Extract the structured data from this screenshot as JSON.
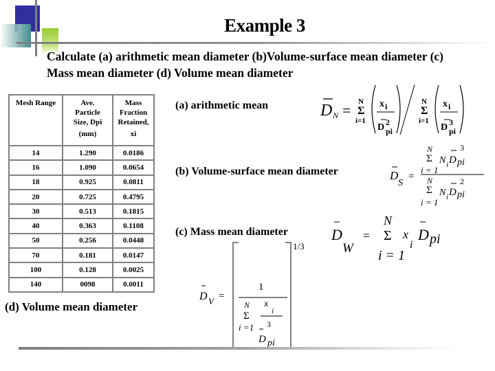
{
  "slide": {
    "title": "Example 3",
    "intro": "Calculate (a) arithmetic mean diameter (b)Volume-surface mean diameter  (c) Mass mean diameter (d) Volume mean diameter"
  },
  "table": {
    "headers": [
      "Mesh Range",
      "Ave. Particle Size, Dpi (mm)",
      "Mass Fraction Retained, xi"
    ],
    "header_lines": [
      [
        "Mesh Range"
      ],
      [
        "Ave.",
        "Particle",
        "Size, Dpi",
        "(mm)"
      ],
      [
        "Mass",
        "Fraction",
        "Retained,",
        "xi"
      ]
    ],
    "rows": [
      [
        "14",
        "1.290",
        "0.0186"
      ],
      [
        "16",
        "1.090",
        "0.0654"
      ],
      [
        "18",
        "0.925",
        "0.0811"
      ],
      [
        "20",
        "0.725",
        "0.4795"
      ],
      [
        "30",
        "0.513",
        "0.1815"
      ],
      [
        "40",
        "0.363",
        "0.1108"
      ],
      [
        "50",
        "0.256",
        "0.0448"
      ],
      [
        "70",
        "0.181",
        "0.0147"
      ],
      [
        "100",
        "0.128",
        "0.0025"
      ],
      [
        "140",
        "0098",
        "0.0011"
      ]
    ]
  },
  "labels": {
    "a": "(a) arithmetic mean",
    "b": "(b) Volume-surface mean diameter",
    "c": "(c) Mass mean diameter",
    "d": "(d) Volume mean diameter"
  },
  "equations": {
    "a": {
      "lhs": "D",
      "lhs_sub": "N",
      "sum_upper": "N",
      "sum_lower": "i=1",
      "num": "x",
      "num_sub": "i",
      "den1": "D",
      "den1_sub": "pi",
      "den1_sup": "2",
      "den2": "D",
      "den2_sub": "pi",
      "den2_sup": "3",
      "sigma": "Σ",
      "eq": "=",
      "slash": "/"
    },
    "b": {
      "lhs": "D",
      "lhs_sub": "S",
      "sum_upper": "N",
      "sum_lower": "i = 1",
      "term_n": "N",
      "term_n_sub": "i",
      "term_d": "D",
      "term_d_sub": "pi",
      "exp_num": "3",
      "exp_den": "2",
      "sigma": "Σ",
      "eq": "="
    },
    "c": {
      "lhs": "D",
      "lhs_sub": "W",
      "sum_upper": "N",
      "sum_lower": "i = 1",
      "term_x": "x",
      "term_x_sub": "i",
      "term_d": "D",
      "term_d_sub": "pi",
      "sigma": "Σ",
      "eq": "="
    },
    "d": {
      "lhs": "D",
      "lhs_sub": "V",
      "numerator": "1",
      "sum_upper": "N",
      "sum_lower": "i =1",
      "term_x": "x",
      "term_x_sub": "i",
      "exp": "3",
      "term_d": "D",
      "term_d_sub": "pi",
      "power": "1/3",
      "sigma": "Σ",
      "eq": "="
    }
  }
}
